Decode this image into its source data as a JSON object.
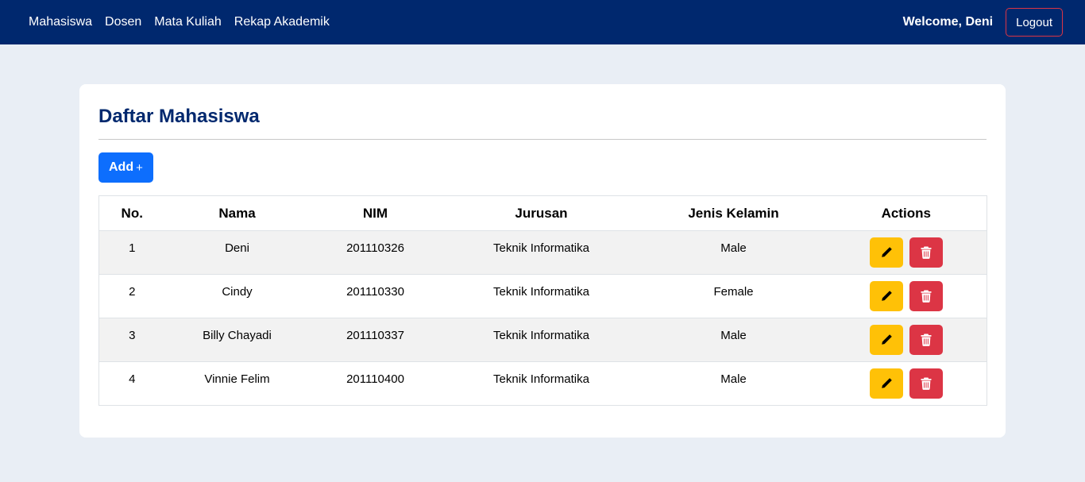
{
  "nav": {
    "links": [
      "Mahasiswa",
      "Dosen",
      "Mata Kuliah",
      "Rekap Akademik"
    ],
    "welcome": "Welcome, Deni",
    "logout": "Logout"
  },
  "page": {
    "title": "Daftar Mahasiswa",
    "add_label": "Add",
    "add_symbol": "+"
  },
  "table": {
    "headers": [
      "No.",
      "Nama",
      "NIM",
      "Jurusan",
      "Jenis Kelamin",
      "Actions"
    ],
    "rows": [
      [
        "1",
        "Deni",
        "201110326",
        "Teknik Informatika",
        "Male"
      ],
      [
        "2",
        "Cindy",
        "201110330",
        "Teknik Informatika",
        "Female"
      ],
      [
        "3",
        "Billy Chayadi",
        "201110337",
        "Teknik Informatika",
        "Male"
      ],
      [
        "4",
        "Vinnie Felim",
        "201110400",
        "Teknik Informatika",
        "Male"
      ]
    ]
  },
  "icons": {
    "edit": "pencil-icon",
    "delete": "trash-icon"
  },
  "colors": {
    "navbar": "#00286e",
    "background": "#e9eef5",
    "primary": "#0d6efd",
    "warning": "#ffc107",
    "danger": "#dc3545"
  }
}
